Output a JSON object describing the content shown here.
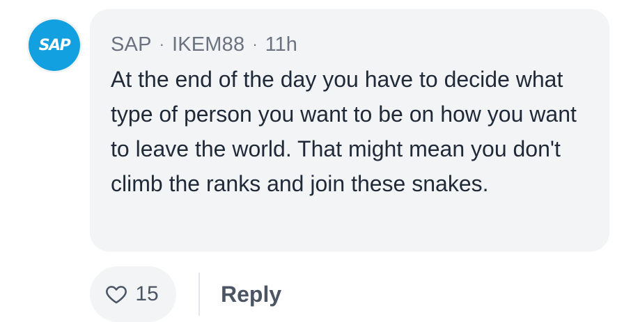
{
  "author": {
    "avatar_text": "SAP",
    "avatar_color": "#12a0e0",
    "company": "SAP",
    "username": "IKEM88",
    "separator": "·",
    "time_ago": "11h"
  },
  "comment": {
    "text": "At the end of the day you have to decide what type of person you want to be on how you want to leave the world. That might mean you don't climb the ranks and join these snakes."
  },
  "actions": {
    "like_icon": "heart-outline-icon",
    "like_count": "15",
    "reply_label": "Reply"
  }
}
